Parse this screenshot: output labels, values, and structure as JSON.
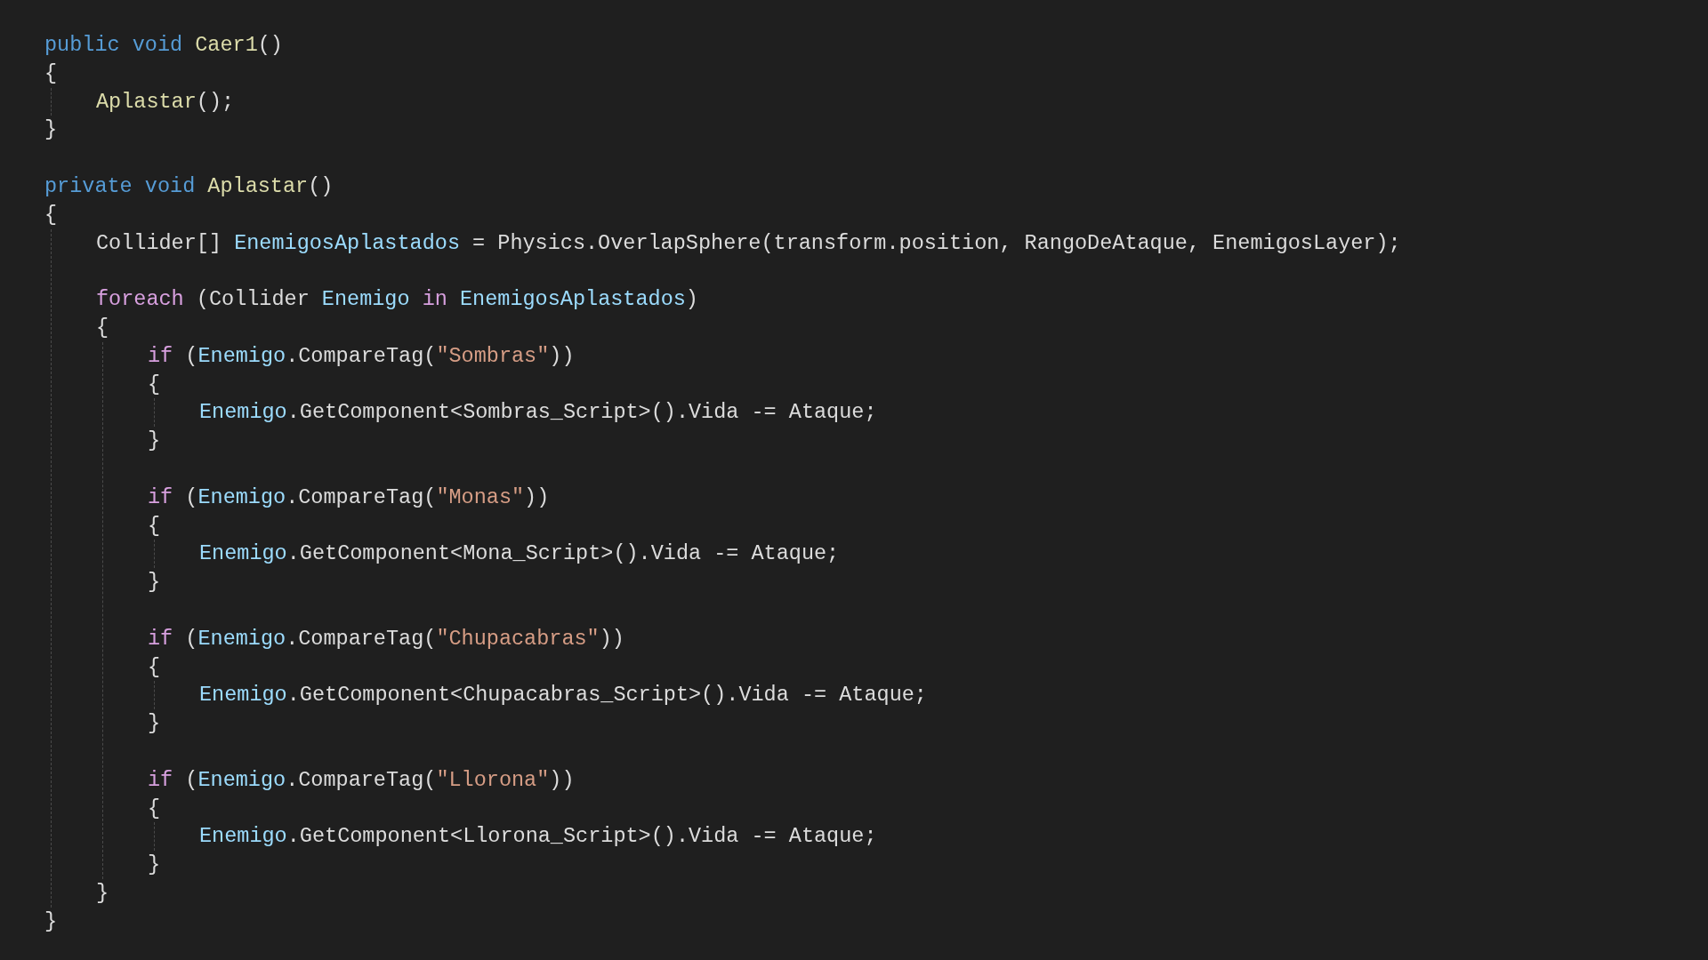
{
  "code": [
    {
      "kind": "line",
      "tokens": [
        {
          "text": "public void ",
          "kind": "keyword"
        },
        {
          "text": "Caer1",
          "kind": "method"
        },
        {
          "text": "()",
          "kind": "plain"
        }
      ]
    },
    {
      "kind": "line",
      "tokens": [
        {
          "text": "{",
          "kind": "plain"
        }
      ]
    },
    {
      "kind": "block",
      "children": [
        {
          "kind": "line",
          "tokens": [
            {
              "text": "Aplastar",
              "kind": "method"
            },
            {
              "text": "();",
              "kind": "plain"
            }
          ]
        }
      ]
    },
    {
      "kind": "line",
      "tokens": [
        {
          "text": "}",
          "kind": "plain"
        }
      ]
    },
    {
      "kind": "blank"
    },
    {
      "kind": "line",
      "tokens": [
        {
          "text": "private void ",
          "kind": "keyword"
        },
        {
          "text": "Aplastar",
          "kind": "method"
        },
        {
          "text": "()",
          "kind": "plain"
        }
      ]
    },
    {
      "kind": "line",
      "tokens": [
        {
          "text": "{",
          "kind": "plain"
        }
      ]
    },
    {
      "kind": "block",
      "children": [
        {
          "kind": "line",
          "tokens": [
            {
              "text": "Collider[] ",
              "kind": "plain"
            },
            {
              "text": "EnemigosAplastados",
              "kind": "variable"
            },
            {
              "text": " = Physics.OverlapSphere(transform.position, RangoDeAtaque, EnemigosLayer);",
              "kind": "plain"
            }
          ]
        },
        {
          "kind": "blank"
        },
        {
          "kind": "line",
          "tokens": [
            {
              "text": "foreach",
              "kind": "control"
            },
            {
              "text": " (Collider ",
              "kind": "plain"
            },
            {
              "text": "Enemigo",
              "kind": "variable"
            },
            {
              "text": " in ",
              "kind": "control"
            },
            {
              "text": "EnemigosAplastados",
              "kind": "variable"
            },
            {
              "text": ")",
              "kind": "plain"
            }
          ]
        },
        {
          "kind": "line",
          "tokens": [
            {
              "text": "{",
              "kind": "plain"
            }
          ]
        },
        {
          "kind": "block",
          "children": [
            {
              "kind": "line",
              "tokens": [
                {
                  "text": "if",
                  "kind": "control"
                },
                {
                  "text": " (",
                  "kind": "plain"
                },
                {
                  "text": "Enemigo",
                  "kind": "variable"
                },
                {
                  "text": ".CompareTag(",
                  "kind": "plain"
                },
                {
                  "text": "\"Sombras\"",
                  "kind": "string"
                },
                {
                  "text": "))",
                  "kind": "plain"
                }
              ]
            },
            {
              "kind": "line",
              "tokens": [
                {
                  "text": "{",
                  "kind": "plain"
                }
              ]
            },
            {
              "kind": "block",
              "children": [
                {
                  "kind": "line",
                  "tokens": [
                    {
                      "text": "Enemigo",
                      "kind": "variable"
                    },
                    {
                      "text": ".GetComponent<Sombras_Script>().Vida -= Ataque;",
                      "kind": "plain"
                    }
                  ]
                }
              ]
            },
            {
              "kind": "line",
              "tokens": [
                {
                  "text": "}",
                  "kind": "plain"
                }
              ]
            },
            {
              "kind": "blank"
            },
            {
              "kind": "line",
              "tokens": [
                {
                  "text": "if",
                  "kind": "control"
                },
                {
                  "text": " (",
                  "kind": "plain"
                },
                {
                  "text": "Enemigo",
                  "kind": "variable"
                },
                {
                  "text": ".CompareTag(",
                  "kind": "plain"
                },
                {
                  "text": "\"Monas\"",
                  "kind": "string"
                },
                {
                  "text": "))",
                  "kind": "plain"
                }
              ]
            },
            {
              "kind": "line",
              "tokens": [
                {
                  "text": "{",
                  "kind": "plain"
                }
              ]
            },
            {
              "kind": "block",
              "children": [
                {
                  "kind": "line",
                  "tokens": [
                    {
                      "text": "Enemigo",
                      "kind": "variable"
                    },
                    {
                      "text": ".GetComponent<Mona_Script>().Vida -= Ataque;",
                      "kind": "plain"
                    }
                  ]
                }
              ]
            },
            {
              "kind": "line",
              "tokens": [
                {
                  "text": "}",
                  "kind": "plain"
                }
              ]
            },
            {
              "kind": "blank"
            },
            {
              "kind": "line",
              "tokens": [
                {
                  "text": "if",
                  "kind": "control"
                },
                {
                  "text": " (",
                  "kind": "plain"
                },
                {
                  "text": "Enemigo",
                  "kind": "variable"
                },
                {
                  "text": ".CompareTag(",
                  "kind": "plain"
                },
                {
                  "text": "\"Chupacabras\"",
                  "kind": "string"
                },
                {
                  "text": "))",
                  "kind": "plain"
                }
              ]
            },
            {
              "kind": "line",
              "tokens": [
                {
                  "text": "{",
                  "kind": "plain"
                }
              ]
            },
            {
              "kind": "block",
              "children": [
                {
                  "kind": "line",
                  "tokens": [
                    {
                      "text": "Enemigo",
                      "kind": "variable"
                    },
                    {
                      "text": ".GetComponent<Chupacabras_Script>().Vida -= Ataque;",
                      "kind": "plain"
                    }
                  ]
                }
              ]
            },
            {
              "kind": "line",
              "tokens": [
                {
                  "text": "}",
                  "kind": "plain"
                }
              ]
            },
            {
              "kind": "blank"
            },
            {
              "kind": "line",
              "tokens": [
                {
                  "text": "if",
                  "kind": "control"
                },
                {
                  "text": " (",
                  "kind": "plain"
                },
                {
                  "text": "Enemigo",
                  "kind": "variable"
                },
                {
                  "text": ".CompareTag(",
                  "kind": "plain"
                },
                {
                  "text": "\"Llorona\"",
                  "kind": "string"
                },
                {
                  "text": "))",
                  "kind": "plain"
                }
              ]
            },
            {
              "kind": "line",
              "tokens": [
                {
                  "text": "{",
                  "kind": "plain"
                }
              ]
            },
            {
              "kind": "block",
              "children": [
                {
                  "kind": "line",
                  "tokens": [
                    {
                      "text": "Enemigo",
                      "kind": "variable"
                    },
                    {
                      "text": ".GetComponent<Llorona_Script>().Vida -= Ataque;",
                      "kind": "plain"
                    }
                  ]
                }
              ]
            },
            {
              "kind": "line",
              "tokens": [
                {
                  "text": "}",
                  "kind": "plain"
                }
              ]
            }
          ]
        },
        {
          "kind": "line",
          "tokens": [
            {
              "text": "}",
              "kind": "plain"
            }
          ]
        }
      ]
    },
    {
      "kind": "line",
      "tokens": [
        {
          "text": "}",
          "kind": "plain"
        }
      ]
    }
  ]
}
